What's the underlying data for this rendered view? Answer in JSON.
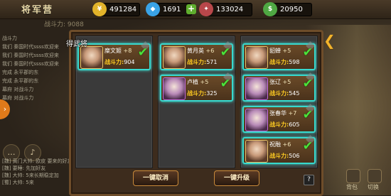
{
  "topbar": {
    "title": "将军营",
    "resources": [
      {
        "icon": "gold-coin-icon",
        "glyph": "¥",
        "color": "#e2b32a",
        "value": "491284"
      },
      {
        "icon": "diamond-icon",
        "glyph": "◆",
        "color": "#3aa3e6",
        "value": "1691"
      },
      {
        "icon": "honor-badge-icon",
        "glyph": "✦",
        "color": "#b8474a",
        "value": "133024"
      },
      {
        "icon": "cash-icon",
        "glyph": "$",
        "color": "#4fa843",
        "value": "20950"
      }
    ]
  },
  "power_strip": "战斗力: 9088",
  "chat": {
    "lines": [
      "战斗力",
      "我们  秦国时代ssss欢迎来",
      "我们  秦国时代ssss欢迎来",
      "我们  秦国时代ssss欢迎来",
      "完成 永平郡的东",
      "完成 永平郡的东",
      "幕府 对战斗力",
      "幕府 对战斗力"
    ],
    "bottom_lines": [
      "[魏] 黄门大帅: 欧皮  要来的好友",
      "[魏] 要睡: 先加好友",
      "[魏] 大帅: 5来长期稳定加",
      "[蜀] 大帅: 5来"
    ]
  },
  "dialog": {
    "popup_text": "得武将",
    "columns": [
      {
        "cards": [
          {
            "name": "糜文姬",
            "level": "+8",
            "power_label": "战斗力:",
            "power": "904",
            "quality": "gold"
          }
        ]
      },
      {
        "cards": [
          {
            "name": "黄月英",
            "level": "+6",
            "power_label": "战斗力:",
            "power": "571",
            "quality": "gold"
          },
          {
            "name": "卢植",
            "level": "+5",
            "power_label": "战斗力:",
            "power": "325",
            "quality": "purple"
          }
        ]
      },
      {
        "cards": [
          {
            "name": "貂蝉",
            "level": "+5",
            "power_label": "战斗力:",
            "power": "598",
            "quality": "gold"
          },
          {
            "name": "张辽",
            "level": "+5",
            "power_label": "战斗力:",
            "power": "545",
            "quality": "purple"
          },
          {
            "name": "张春华",
            "level": "+7",
            "power_label": "战斗力:",
            "power": "605",
            "quality": "purple"
          },
          {
            "name": "祝融",
            "level": "+6",
            "power_label": "战斗力:",
            "power": "506",
            "quality": "gold"
          }
        ]
      }
    ],
    "cancel_button": "一键取消",
    "upgrade_button": "一键升级",
    "help_label": "?"
  },
  "bottom_nav": [
    "背包",
    "切换"
  ]
}
